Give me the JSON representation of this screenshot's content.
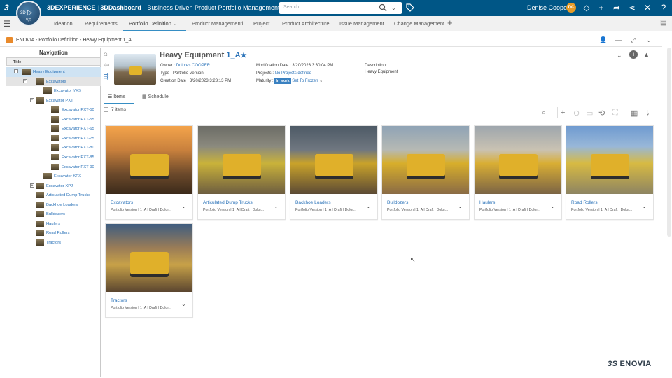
{
  "topbar": {
    "brand_bold": "3DEXPERIENCE",
    "brand_sep": "|",
    "brand_dash": "3DDashboard",
    "dashboard_name": "Business Driven Product Portfolio Management",
    "search_placeholder": "Search",
    "user_name": "Denise Cooper",
    "user_initials": "DC",
    "compass_label": "3D",
    "compass_vr": "V,R"
  },
  "tabs": [
    {
      "label": "Ideation"
    },
    {
      "label": "Requirements"
    },
    {
      "label": "Portfolio Definition"
    },
    {
      "label": "Product Managementl"
    },
    {
      "label": "Project"
    },
    {
      "label": "Product Architecture"
    },
    {
      "label": "Issue Management"
    },
    {
      "label": "Change Management"
    }
  ],
  "widget": {
    "title": "ENOVIA - Portfolio Definition - Heavy Equipment 1_A"
  },
  "navigation": {
    "heading": "Navigation",
    "column_title": "Title",
    "items": [
      {
        "label": "Heavy Equipment",
        "toggle": "-"
      },
      {
        "label": "Excavators",
        "toggle": "-"
      },
      {
        "label": "Excavator YXS",
        "toggle": ""
      },
      {
        "label": "Excavator PXT",
        "toggle": "-"
      },
      {
        "label": "Excavator PXT-50",
        "toggle": ""
      },
      {
        "label": "Excavator PXT-55",
        "toggle": ""
      },
      {
        "label": "Excavator PXT-65",
        "toggle": ""
      },
      {
        "label": "Excavator PXT-75",
        "toggle": ""
      },
      {
        "label": "Excavator PXT-80",
        "toggle": ""
      },
      {
        "label": "Excavator PXT-85",
        "toggle": ""
      },
      {
        "label": "Excavator PXT-90",
        "toggle": ""
      },
      {
        "label": "Excavator KPX",
        "toggle": ""
      },
      {
        "label": "Excavator XPJ",
        "toggle": "+"
      },
      {
        "label": "Articulated Dump Trucks",
        "toggle": ""
      },
      {
        "label": "Backhoe Loaders",
        "toggle": ""
      },
      {
        "label": "Bulldozers",
        "toggle": ""
      },
      {
        "label": "Haulers",
        "toggle": ""
      },
      {
        "label": "Road Rollers",
        "toggle": ""
      },
      {
        "label": "Tractors",
        "toggle": ""
      }
    ]
  },
  "portfolio": {
    "name": "Heavy Equipment",
    "revision": "1_A",
    "owner_label": "Owner :",
    "owner_value": "Dolores COOPER",
    "type_label": "Type :",
    "type_value": "Portfolio Version",
    "creation_label": "Creation Date :",
    "creation_value": "3/20/2023 3:23:13 PM",
    "modification_label": "Modification Date :",
    "modification_value": "3/20/2023 3:30:04 PM",
    "projects_label": "Projects :",
    "projects_value": "No Projects defined",
    "maturity_label": "Maturity :",
    "maturity_state": "In work",
    "maturity_action": "Set To Frozen",
    "description_label": "Description:",
    "description_value": "Heavy Equipment"
  },
  "subtabs": {
    "items": "Items",
    "schedule": "Schedule"
  },
  "items_count": "7 items",
  "cards": [
    {
      "name": "Excavators",
      "details": "Portfolio Version | 1_A | Draft | Dolor..."
    },
    {
      "name": "Articulated Dump Trucks",
      "details": "Portfolio Version | 1_A | Draft | Dolor..."
    },
    {
      "name": "Backhoe Loaders",
      "details": "Portfolio Version | 1_A | Draft | Dolor..."
    },
    {
      "name": "Bulldozers",
      "details": "Portfolio Version | 1_A | Draft | Dolor..."
    },
    {
      "name": "Haulers",
      "details": "Portfolio Version | 1_A | Draft | Dolor..."
    },
    {
      "name": "Road Rollers",
      "details": "Portfolio Version | 1_A | Draft | Dolor..."
    },
    {
      "name": "Tractors",
      "details": "Portfolio Version | 1_A | Draft | Dolor..."
    }
  ],
  "footer_brand": "ENOVIA",
  "colors": {
    "topbar": "#005686",
    "accent": "#368ec4",
    "link": "#2a72b8"
  }
}
